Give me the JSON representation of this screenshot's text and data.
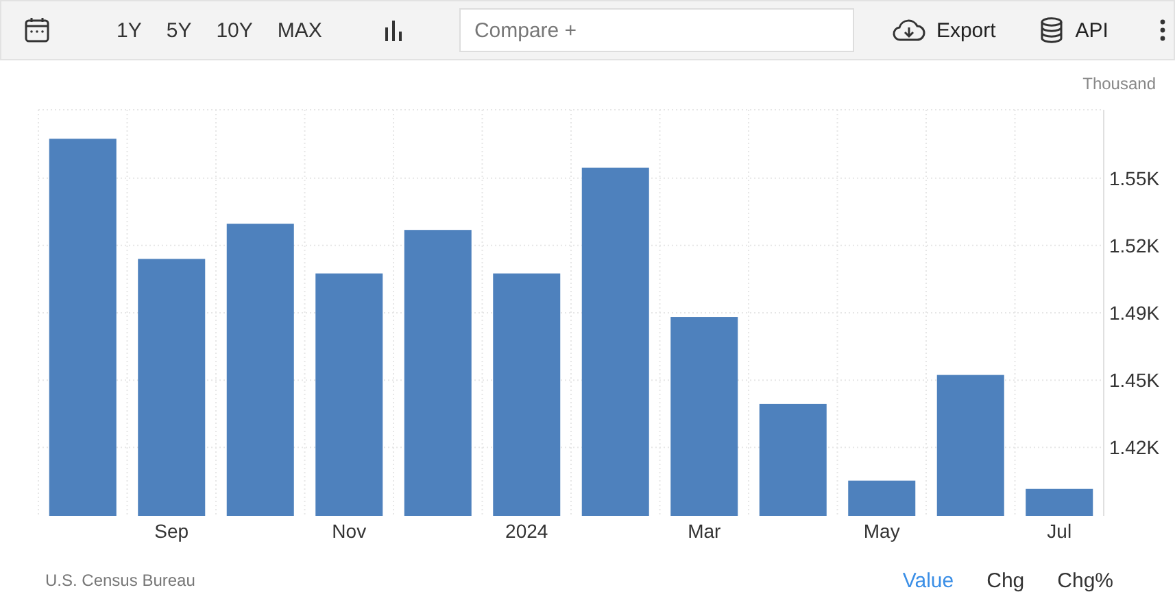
{
  "toolbar": {
    "ranges": [
      {
        "label": "1Y"
      },
      {
        "label": "5Y"
      },
      {
        "label": "10Y"
      },
      {
        "label": "MAX"
      }
    ],
    "compare": {
      "placeholder": "Compare +"
    },
    "export": "Export",
    "api": "API"
  },
  "chart": {
    "unit": "Thousand",
    "chart_data": {
      "type": "bar",
      "grid": true,
      "categories": [
        null,
        "Sep",
        null,
        "Nov",
        null,
        "2024",
        null,
        "Mar",
        null,
        "May",
        null,
        "Jul"
      ],
      "series": [
        {
          "color": "#4e81bd",
          "values": [
            1.569,
            1.511,
            1.528,
            1.504,
            1.525,
            1.504,
            1.555,
            1.483,
            1.441,
            1.404,
            1.455,
            1.4
          ]
        }
      ],
      "ylim": [
        1.387,
        1.583
      ],
      "yticks": [
        {
          "value": 1.42,
          "label": "1.42K"
        },
        {
          "value": 1.4525,
          "label": "1.45K"
        },
        {
          "value": 1.485,
          "label": "1.49K"
        },
        {
          "value": 1.5175,
          "label": "1.52K"
        },
        {
          "value": 1.55,
          "label": "1.55K"
        }
      ]
    }
  },
  "footer": {
    "source": "U.S. Census Bureau",
    "modes": [
      {
        "label": "Value",
        "selected": true
      },
      {
        "label": "Chg",
        "selected": false
      },
      {
        "label": "Chg%",
        "selected": false
      }
    ]
  }
}
